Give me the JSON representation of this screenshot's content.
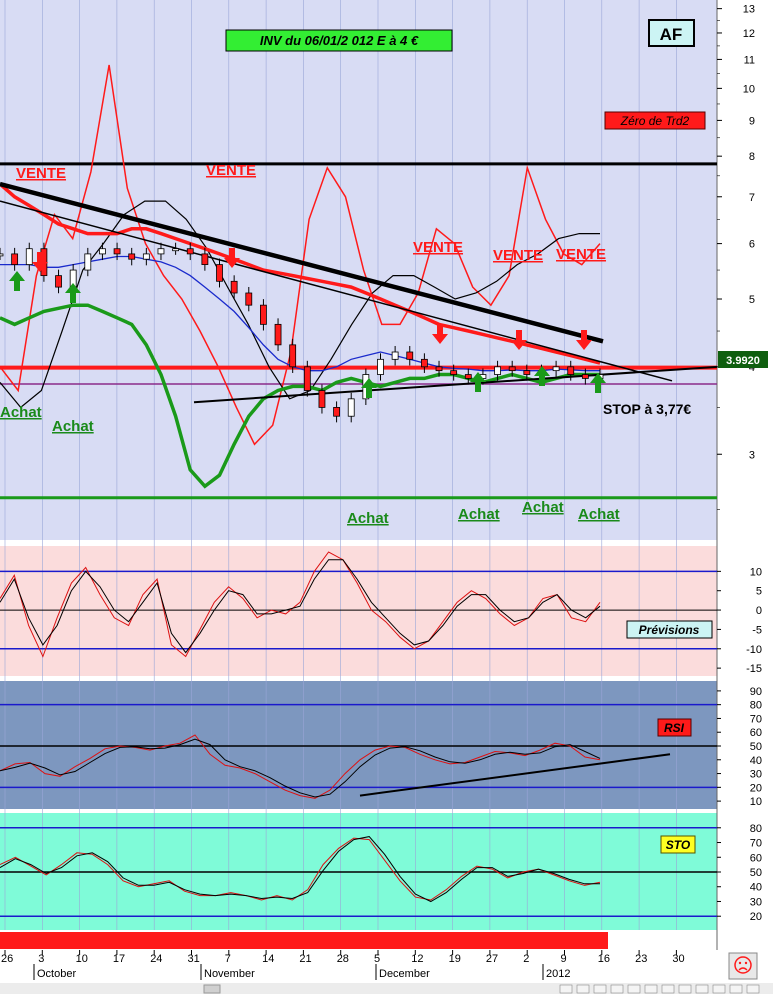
{
  "header": {
    "title": "INV du 06/01/2 012     E à  4 €",
    "badge": "AF"
  },
  "colors": {
    "main_bg": "#d8dcf4",
    "previsions_bg": "#fbdcdc",
    "rsi_bg": "#7d97bf",
    "sto_bg": "#7ffbd8",
    "accent_red": "#ff1a1a",
    "accent_green": "#1a9a1a",
    "title_box": "#33ee33",
    "price_tag": "#0f5f0f"
  },
  "chart_data": [
    {
      "type": "line",
      "name": "price",
      "x_ticks": [
        "26",
        "3",
        "10",
        "17",
        "24",
        "31",
        "7",
        "14",
        "21",
        "28",
        "5",
        "12",
        "19",
        "27",
        "2",
        "9",
        "16",
        "23",
        "30"
      ],
      "months": [
        "October",
        "November",
        "December",
        "2012"
      ],
      "y_axis": {
        "labels": [
          "13",
          "12",
          "11",
          "10",
          "9",
          "8",
          "7",
          "6",
          "5",
          "4",
          "3"
        ],
        "scale": "log"
      },
      "ylim": [
        2.3,
        13.2
      ],
      "last_price": "3.9920",
      "close": [
        5.8,
        5.6,
        5.9,
        5.4,
        5.2,
        5.5,
        5.8,
        5.9,
        5.8,
        5.7,
        5.8,
        5.9,
        5.9,
        5.8,
        5.6,
        5.3,
        5.1,
        4.9,
        4.6,
        4.3,
        4.0,
        3.7,
        3.5,
        3.4,
        3.6,
        3.9,
        4.1,
        4.2,
        4.1,
        4.0,
        3.95,
        3.9,
        3.85,
        3.9,
        4.0,
        3.95,
        3.9,
        3.95,
        4.0,
        3.9,
        3.85,
        3.9
      ],
      "bollinger_upper": [
        7.3,
        7.0,
        6.8,
        6.6,
        6.4,
        6.3,
        6.2,
        6.2,
        6.2,
        6.3,
        6.3,
        6.2,
        6.1,
        6.0,
        5.9,
        5.8,
        5.7,
        5.6,
        5.5,
        5.45,
        5.4,
        5.35,
        5.3,
        5.25,
        5.2,
        5.1,
        5.0,
        4.9,
        4.8,
        4.7,
        4.6,
        4.55,
        4.5,
        4.45,
        4.4,
        4.35,
        4.3,
        4.25,
        4.2,
        4.15,
        4.1,
        4.05
      ],
      "bollinger_lower": [
        4.7,
        4.6,
        4.7,
        4.8,
        4.85,
        4.9,
        4.9,
        4.8,
        4.7,
        4.6,
        4.3,
        3.9,
        3.4,
        2.85,
        2.7,
        2.8,
        3.1,
        3.4,
        3.6,
        3.7,
        3.75,
        3.75,
        3.7,
        3.8,
        3.85,
        3.8,
        3.75,
        3.8,
        3.85,
        3.85,
        3.9,
        3.9,
        3.85,
        3.8,
        3.85,
        3.9,
        3.85,
        3.8,
        3.85,
        3.9,
        3.9,
        3.9
      ],
      "moving_average": [
        5.6,
        5.6,
        5.6,
        5.55,
        5.55,
        5.6,
        5.65,
        5.7,
        5.75,
        5.75,
        5.7,
        5.65,
        5.55,
        5.4,
        5.2,
        5.0,
        4.8,
        4.55,
        4.3,
        4.1,
        4.0,
        3.95,
        3.95,
        4.0,
        4.1,
        4.15,
        4.2,
        4.15,
        4.1,
        4.05,
        4.0,
        3.98,
        3.97,
        3.95,
        3.95,
        3.96,
        3.95,
        3.95,
        3.97,
        3.96,
        3.95,
        3.95
      ],
      "oscillator_red": [
        4.0,
        3.7,
        5.4,
        6.6,
        6.1,
        7.6,
        10.8,
        7.2,
        6.0,
        5.4,
        5.0,
        4.5,
        4.0,
        3.5,
        3.1,
        3.3,
        4.2,
        6.5,
        7.7,
        7.0,
        5.5,
        4.6,
        4.6,
        5.1,
        6.3,
        6.0,
        5.2,
        4.9,
        5.4,
        7.7,
        6.5,
        5.8,
        5.6,
        6.0
      ],
      "oscillator_black": [
        3.8,
        3.5,
        3.7,
        4.5,
        5.5,
        6.0,
        6.6,
        6.9,
        6.9,
        6.5,
        5.9,
        5.2,
        4.6,
        4.0,
        3.6,
        3.7,
        4.1,
        4.6,
        5.1,
        5.4,
        5.4,
        5.2,
        5.0,
        5.1,
        5.3,
        5.6,
        5.8,
        6.1,
        6.2,
        6.2
      ],
      "horizontal_lines": {
        "resistance": 7.8,
        "support_red": 3.99,
        "purple": 3.78,
        "green_bottom": 2.6
      },
      "annotations": {
        "vente": [
          "VENTE",
          "VENTE",
          "VENTE",
          "VENTE",
          "VENTE"
        ],
        "achat": [
          "Achat",
          "Achat",
          "Achat",
          "Achat",
          "Achat",
          "Achat"
        ],
        "stop": "STOP à 3,77€",
        "zero_label": "Zéro de Trd2"
      }
    },
    {
      "type": "line",
      "name": "Prévisions",
      "y_axis": {
        "labels": [
          "10",
          "5",
          "0",
          "-5",
          "-10",
          "-15"
        ]
      },
      "ylim": [
        -16,
        15
      ],
      "bands": [
        10,
        -10
      ],
      "series_red": [
        3,
        9,
        -4,
        -12,
        -2,
        7,
        11,
        4,
        -2,
        -4,
        4,
        8,
        -9,
        -12,
        -5,
        2,
        6,
        3,
        -2,
        0,
        -1,
        2,
        10,
        15,
        13,
        7,
        0,
        -3,
        -7,
        -10,
        -8,
        -3,
        2,
        5,
        3,
        -1,
        -4,
        -2,
        3,
        4,
        -2,
        -3,
        2
      ],
      "series_black": [
        2,
        8,
        -2,
        -9,
        -4,
        5,
        10,
        6,
        0,
        -3,
        2,
        7,
        -6,
        -11,
        -6,
        0,
        5,
        4,
        -1,
        -1,
        0,
        1,
        8,
        13,
        13,
        8,
        2,
        -2,
        -6,
        -9,
        -8,
        -4,
        1,
        4,
        4,
        0,
        -3,
        -2,
        2,
        4,
        0,
        -2,
        1
      ]
    },
    {
      "type": "line",
      "name": "RSI",
      "y_axis": {
        "labels": [
          "90",
          "80",
          "70",
          "60",
          "50",
          "40",
          "30",
          "20",
          "10"
        ]
      },
      "ylim": [
        5,
        95
      ],
      "bands": [
        80,
        20,
        50
      ],
      "series": [
        32,
        37,
        38,
        30,
        28,
        35,
        41,
        48,
        50,
        49,
        47,
        50,
        52,
        58,
        44,
        36,
        34,
        30,
        24,
        18,
        14,
        12,
        18,
        30,
        40,
        47,
        50,
        49,
        44,
        40,
        37,
        38,
        42,
        46,
        45,
        43,
        47,
        52,
        50,
        42,
        40
      ],
      "trendline": [
        [
          24,
          14
        ],
        [
          43,
          44
        ]
      ]
    },
    {
      "type": "line",
      "name": "STO",
      "y_axis": {
        "labels": [
          "80",
          "70",
          "60",
          "50",
          "40",
          "30",
          "20"
        ]
      },
      "ylim": [
        12,
        88
      ],
      "bands": [
        80,
        20,
        50
      ],
      "series_red": [
        55,
        60,
        54,
        48,
        55,
        63,
        62,
        55,
        44,
        40,
        42,
        44,
        37,
        34,
        34,
        36,
        34,
        31,
        34,
        31,
        38,
        55,
        66,
        73,
        72,
        58,
        44,
        33,
        31,
        38,
        47,
        54,
        52,
        46,
        50,
        52,
        48,
        44,
        41,
        43
      ],
      "series_black": [
        53,
        59,
        55,
        49,
        53,
        61,
        63,
        57,
        46,
        41,
        41,
        43,
        38,
        35,
        34,
        35,
        34,
        32,
        33,
        32,
        36,
        51,
        64,
        72,
        74,
        62,
        47,
        35,
        30,
        36,
        45,
        53,
        53,
        47,
        49,
        52,
        49,
        45,
        42,
        42
      ]
    }
  ]
}
